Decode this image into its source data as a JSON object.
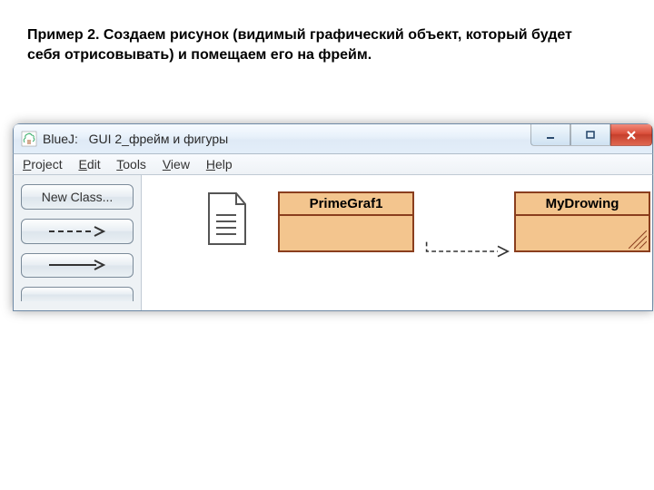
{
  "caption": "Пример 2. Создаем рисунок (видимый графический объект, который будет себя отрисовывать) и помещаем его на фрейм.",
  "titlebar": {
    "appname": "BlueJ:",
    "project": "GUI 2_фрейм и фигуры"
  },
  "menu": {
    "project": "Project",
    "edit": "Edit",
    "tools": "Tools",
    "view": "View",
    "help": "Help"
  },
  "toolbar": {
    "newclass": "New Class..."
  },
  "canvas": {
    "class1": "PrimeGraf1",
    "class2": "MyDrowing"
  }
}
